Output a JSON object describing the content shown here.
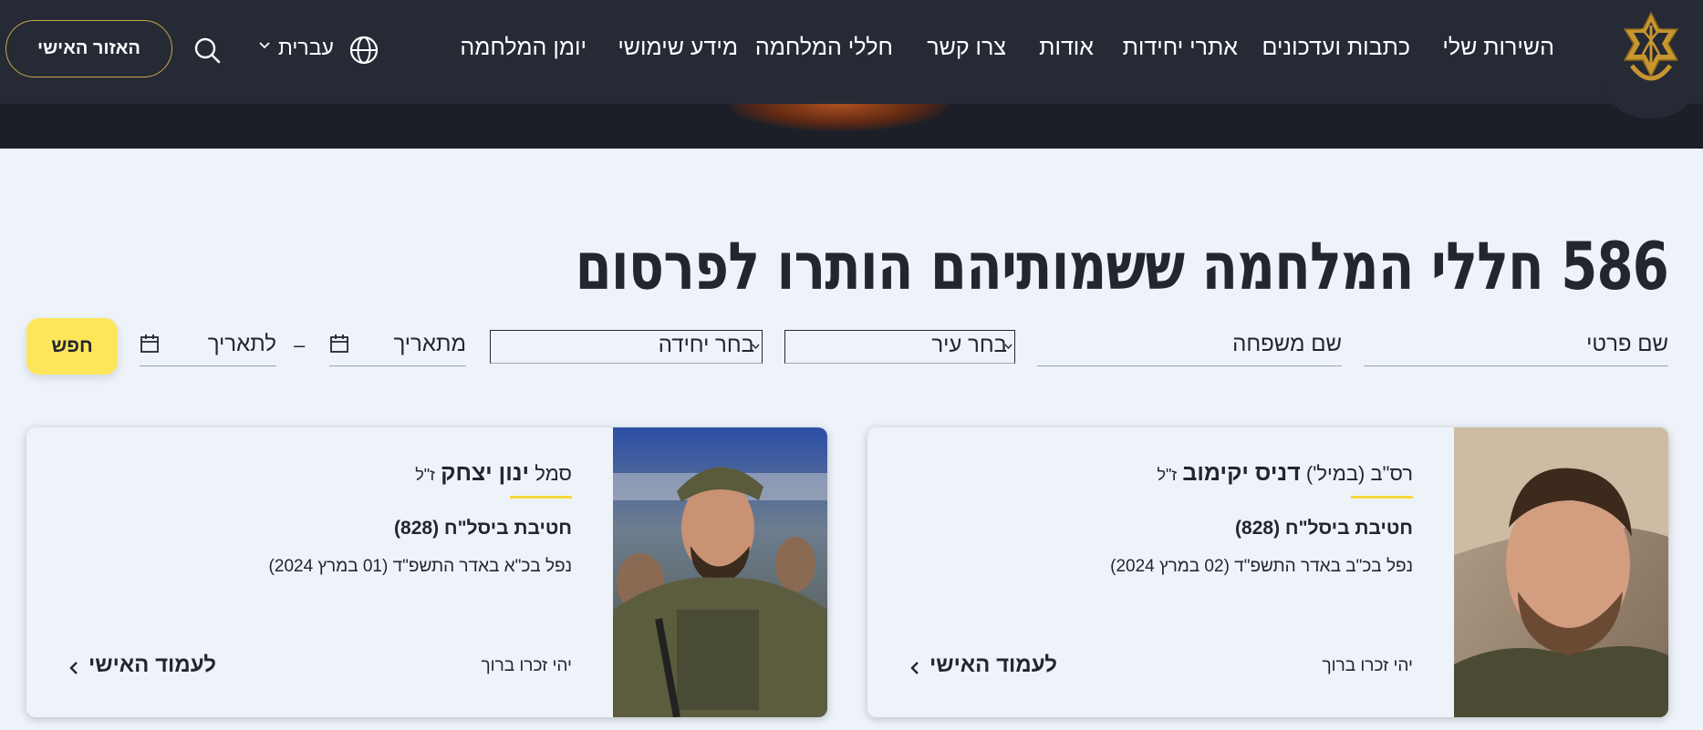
{
  "nav": {
    "links": [
      "השירות שלי",
      "כתבות ועדכונים",
      "אתרי יחידות",
      "אודות",
      "צרו קשר",
      "חללי המלחמה",
      "מידע שימושי",
      "יומן המלחמה"
    ],
    "language": "עברית",
    "personal_area": "האזור האישי",
    "logo_icon": "idf-emblem-icon"
  },
  "page": {
    "title": "586 חללי המלחמה ששמותיהם הותרו לפרסום"
  },
  "filters": {
    "first_name": "שם פרטי",
    "last_name": "שם משפחה",
    "city": "בחר עיר",
    "unit": "בחר יחידה",
    "from_date": "מתאריך",
    "to_date": "לתאריך",
    "dash": "–",
    "search_button": "חפש",
    "accent_color": "#fde65a"
  },
  "cards": [
    {
      "rank": "רס\"ב",
      "rank_extra": "(במיל')",
      "name": "דניס יקימוב",
      "suffix": "ז\"ל",
      "unit": "חטיבת ביסל\"ח (828)",
      "fell": "נפל בכ\"ב באדר התשפ\"ד (02 במרץ 2024)",
      "memory": "יהי זכרו ברוך",
      "link": "לעמוד האישי"
    },
    {
      "rank": "סמל",
      "rank_extra": "",
      "name": "ינון יצחק",
      "suffix": "ז\"ל",
      "unit": "חטיבת ביסל\"ח (828)",
      "fell": "נפל בכ\"א באדר התשפ\"ד (01 במרץ 2024)",
      "memory": "יהי זכרו ברוך",
      "link": "לעמוד האישי"
    }
  ]
}
